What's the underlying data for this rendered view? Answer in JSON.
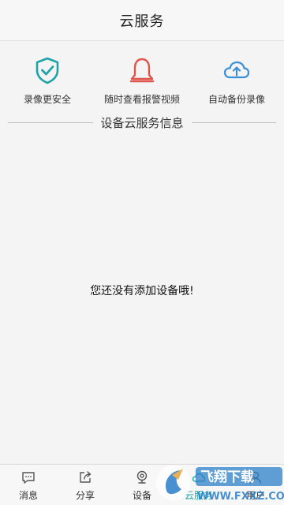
{
  "header": {
    "title": "云服务"
  },
  "features": [
    {
      "icon": "shield-check-icon",
      "label": "录像更安全",
      "color": "#1fa3a8"
    },
    {
      "icon": "bell-icon",
      "label": "随时查看报警视频",
      "color": "#e0554b"
    },
    {
      "icon": "cloud-upload-icon",
      "label": "自动备份录像",
      "color": "#3a8fd6"
    }
  ],
  "section": {
    "title": "设备云服务信息"
  },
  "empty": {
    "message": "您还没有添加设备哦!"
  },
  "tabs": [
    {
      "icon": "message-icon",
      "label": "消息",
      "active": false
    },
    {
      "icon": "share-icon",
      "label": "分享",
      "active": false
    },
    {
      "icon": "device-icon",
      "label": "设备",
      "active": false
    },
    {
      "icon": "cloud-icon",
      "label": "云服务",
      "active": true
    },
    {
      "icon": "user-icon",
      "label": "用户",
      "active": false
    }
  ],
  "colors": {
    "accent": "#1fa3a8"
  }
}
